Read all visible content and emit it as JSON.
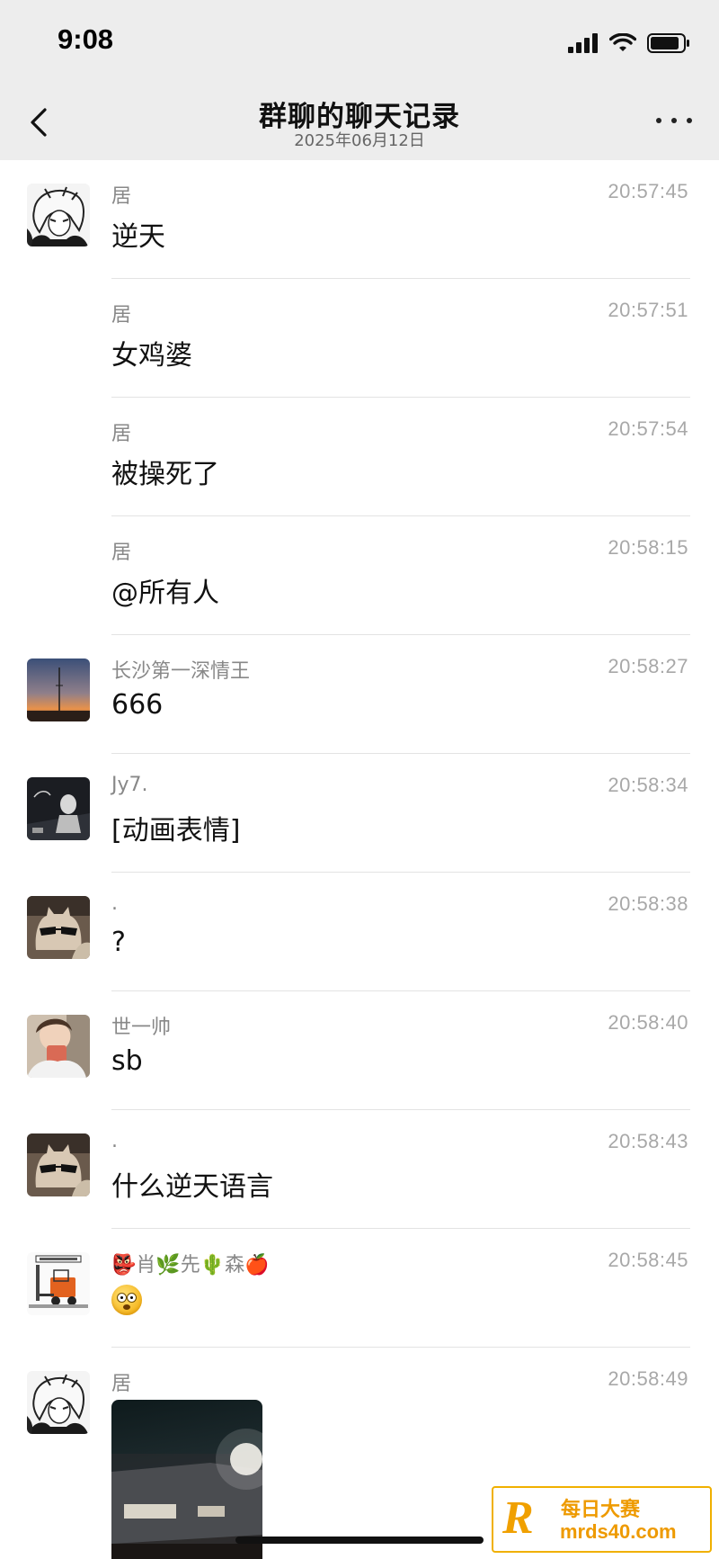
{
  "status_bar": {
    "time": "9:08"
  },
  "header": {
    "title": "群聊的聊天记录",
    "date": "2025年06月12日"
  },
  "messages": [
    {
      "avatar": "anime-girl-avatar",
      "sender": "居",
      "time": "20:57:45",
      "text": "逆天"
    },
    {
      "avatar": "",
      "sender": "居",
      "time": "20:57:51",
      "text": "女鸡婆"
    },
    {
      "avatar": "",
      "sender": "居",
      "time": "20:57:54",
      "text": "被操死了"
    },
    {
      "avatar": "",
      "sender": "居",
      "time": "20:58:15",
      "text": "@所有人"
    },
    {
      "avatar": "sunset-avatar",
      "sender": "长沙第一深情王",
      "time": "20:58:27",
      "text": "666"
    },
    {
      "avatar": "dark-photo-avatar",
      "sender": "Jy7.",
      "time": "20:58:34",
      "text": "[动画表情]"
    },
    {
      "avatar": "cat-sunglasses-avatar",
      "sender": ".",
      "time": "20:58:38",
      "text": "?"
    },
    {
      "avatar": "boy-selfie-avatar",
      "sender": "世一帅",
      "time": "20:58:40",
      "text": "sb"
    },
    {
      "avatar": "cat-sunglasses-avatar",
      "sender": ".",
      "time": "20:58:43",
      "text": "什么逆天语言"
    },
    {
      "avatar": "forklift-avatar",
      "sender": "👺肖🌿先🌵森🍎",
      "time": "20:58:45",
      "text": "",
      "emoji": "astonished-face"
    },
    {
      "avatar": "anime-girl-avatar",
      "sender": "居",
      "time": "20:58:49",
      "text": "",
      "image": "night-street-photo"
    }
  ],
  "watermark": {
    "letter": "R",
    "title": "每日大赛",
    "url": "mrds40.com"
  }
}
